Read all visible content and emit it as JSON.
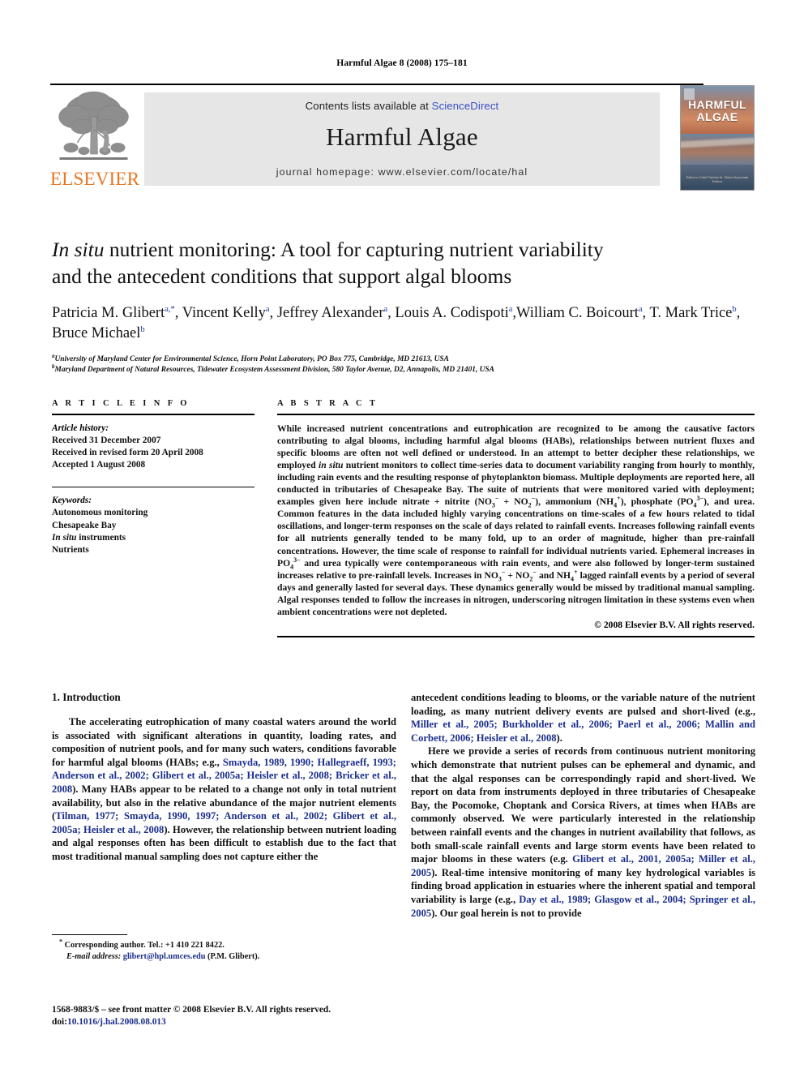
{
  "running_head": "Harmful Algae 8 (2008) 175–181",
  "masthead": {
    "contents_prefix": "Contents lists available at ",
    "sciencedirect": "ScienceDirect",
    "journal_name": "Harmful Algae",
    "journal_homepage": "journal homepage: www.elsevier.com/locate/hal",
    "publisher_wordmark": "ELSEVIER",
    "publisher_color": "#E87722",
    "link_color": "#3a4fc4",
    "cover_title_line1": "HARMFUL",
    "cover_title_line2": "ALGAE",
    "cover_byline": "Editor-in-Chief\nPatricia M. Glibert\nAssociate Editors"
  },
  "article": {
    "title_line1_italic": "In situ",
    "title_line1_rest": " nutrient monitoring: A tool for capturing nutrient variability",
    "title_line2": "and the antecedent conditions that support algal blooms",
    "authors": [
      {
        "name": "Patricia M. Glibert",
        "marks": "a,*",
        "sep": ", "
      },
      {
        "name": "Vincent Kelly",
        "marks": "a",
        "sep": ", "
      },
      {
        "name": "Jeffrey Alexander",
        "marks": "a",
        "sep": ", "
      },
      {
        "name": "Louis A. Codispoti",
        "marks": "a",
        "sep": ","
      },
      {
        "name": "William C. Boicourt",
        "marks": "a",
        "sep": ", "
      },
      {
        "name": "T. Mark Trice",
        "marks": "b",
        "sep": ", "
      },
      {
        "name": "Bruce Michael",
        "marks": "b",
        "sep": ""
      }
    ],
    "affiliations": [
      {
        "mark": "a",
        "text": "University of Maryland Center for Environmental Science, Horn Point Laboratory, PO Box 775, Cambridge, MD 21613, USA"
      },
      {
        "mark": "b",
        "text": "Maryland Department of Natural Resources, Tidewater Ecosystem Assessment Division, 580 Taylor Avenue, D2, Annapolis, MD 21401, USA"
      }
    ]
  },
  "article_info": {
    "heading": "A R T I C L E  I N F O",
    "history_label": "Article history:",
    "history": [
      "Received 31 December 2007",
      "Received in revised form 20 April 2008",
      "Accepted 1 August 2008"
    ],
    "keywords_label": "Keywords:",
    "keywords": [
      "Autonomous monitoring",
      "Chesapeake Bay",
      "In situ instruments",
      "Nutrients"
    ]
  },
  "abstract": {
    "heading": "A B S T R A C T",
    "copyright": "© 2008 Elsevier B.V. All rights reserved."
  },
  "body": {
    "intro_heading": "1. Introduction",
    "left_para1": "The accelerating eutrophication of many coastal waters around the world is associated with significant alterations in quantity, loading rates, and composition of nutrient pools, and for many such waters, conditions favorable for harmful algal blooms (HABs; e.g., ",
    "left_cite1": "Smayda, 1989, 1990; Hallegraeff, 1993; Anderson et al., 2002; Glibert et al., 2005a; Heisler et al., 2008; Bricker et al., 2008",
    "left_para1b": "). Many HABs appear to be related to a change not only in total nutrient availability, but also in the relative abundance of the major nutrient elements (",
    "left_cite2": "Tilman, 1977; Smayda, 1990, 1997; Anderson et al., 2002; Glibert et al., 2005a; Heisler et al., 2008",
    "left_para1c": "). However, the relationship between nutrient loading and algal responses often has been difficult to establish due to the fact that most traditional manual sampling does not capture either the",
    "right_para1a": "antecedent conditions leading to blooms, or the variable nature of the nutrient loading, as many nutrient delivery events are pulsed and short-lived (e.g., ",
    "right_cite1": "Miller et al., 2005; Burkholder et al., 2006; Paerl et al., 2006; Mallin and Corbett, 2006; Heisler et al., 2008",
    "right_para1b": ").",
    "right_para2a": "Here we provide a series of records from continuous nutrient monitoring which demonstrate that nutrient pulses can be ephemeral and dynamic, and that the algal responses can be correspondingly rapid and short-lived. We report on data from instruments deployed in three tributaries of Chesapeake Bay, the Pocomoke, Choptank and Corsica Rivers, at times when HABs are commonly observed. We were particularly interested in the relationship between rainfall events and the changes in nutrient availability that follows, as both small-scale rainfall events and large storm events have been related to major blooms in these waters (e.g. ",
    "right_cite2": "Glibert et al., 2001, 2005a; Miller et al., 2005",
    "right_para2b": "). Real-time intensive monitoring of many key hydrological variables is finding broad application in estuaries where the inherent spatial and temporal variability is large (e.g., ",
    "right_cite3": "Day et al., 1989; Glasgow et al., 2004; Springer et al., 2005",
    "right_para2c": "). Our goal herein is not to provide"
  },
  "footnotes": {
    "corresponding": "Corresponding author. Tel.: +1 410 221 8422.",
    "email_label": "E-mail address:",
    "email": "glibert@hpl.umces.edu",
    "email_suffix": " (P.M. Glibert).",
    "issn_line1": "1568-9883/$ – see front matter © 2008 Elsevier B.V. All rights reserved.",
    "doi_label": "doi:",
    "doi": "10.1016/j.hal.2008.08.013"
  }
}
